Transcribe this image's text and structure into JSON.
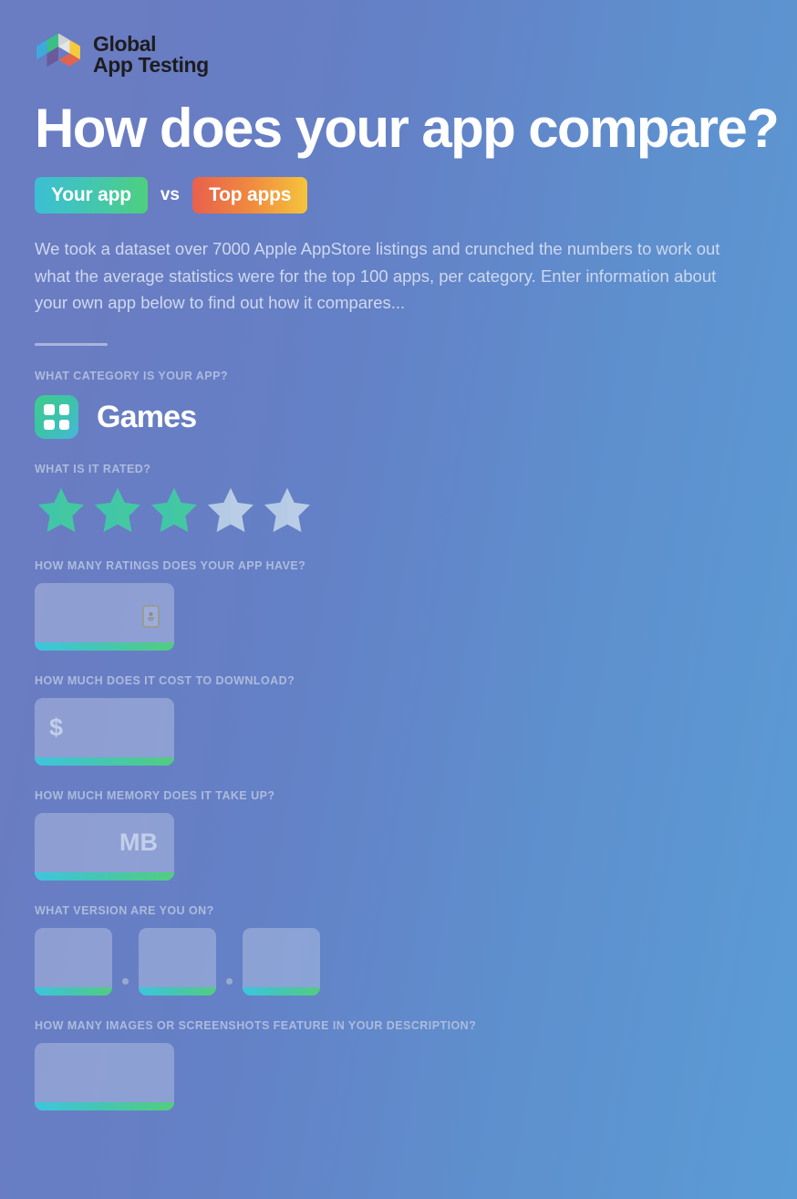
{
  "brand": {
    "logo_icon": "hexagon-logo-icon",
    "line1": "Global",
    "line2": "App Testing"
  },
  "hero": {
    "headline": "How does your app compare?",
    "badge_your_app": "Your app",
    "vs": "vs",
    "badge_top_apps": "Top apps",
    "intro": "We took a dataset over 7000 Apple AppStore listings and crunched the numbers to work out what the average statistics were for the top 100 apps, per category. Enter information about your own app below to find out how it compares..."
  },
  "form": {
    "category": {
      "label": "WHAT CATEGORY IS YOUR APP?",
      "selected": "Games",
      "icon": "grid-apps-icon"
    },
    "rating": {
      "label": "WHAT IS IT RATED?",
      "value": 3,
      "max": 5,
      "filled_color": "#43c9a0",
      "empty_color": "#b9cbe4"
    },
    "ratings_count": {
      "label": "HOW MANY RATINGS DOES YOUR APP HAVE?",
      "value": "",
      "placeholder": "",
      "icon": "id-badge-icon"
    },
    "price": {
      "label": "HOW MUCH DOES IT COST TO DOWNLOAD?",
      "value": "",
      "placeholder": "",
      "prefix": "$"
    },
    "memory": {
      "label": "HOW MUCH MEMORY DOES IT TAKE UP?",
      "value": "",
      "placeholder": "",
      "suffix": "MB"
    },
    "version": {
      "label": "WHAT VERSION ARE YOU ON?",
      "major": "",
      "minor": "",
      "patch": "",
      "separator": "."
    },
    "screenshots": {
      "label": "HOW MANY IMAGES OR SCREENSHOTS FEATURE IN YOUR DESCRIPTION?",
      "value": "",
      "placeholder": ""
    }
  },
  "theme": {
    "bg_left": "#6a7cc2",
    "bg_right": "#5a9cd6",
    "accent_green": "#4ecf7f",
    "accent_blue": "#3bbfd4",
    "accent_orange": "#f0893f",
    "label_color": "#adbbdd"
  }
}
